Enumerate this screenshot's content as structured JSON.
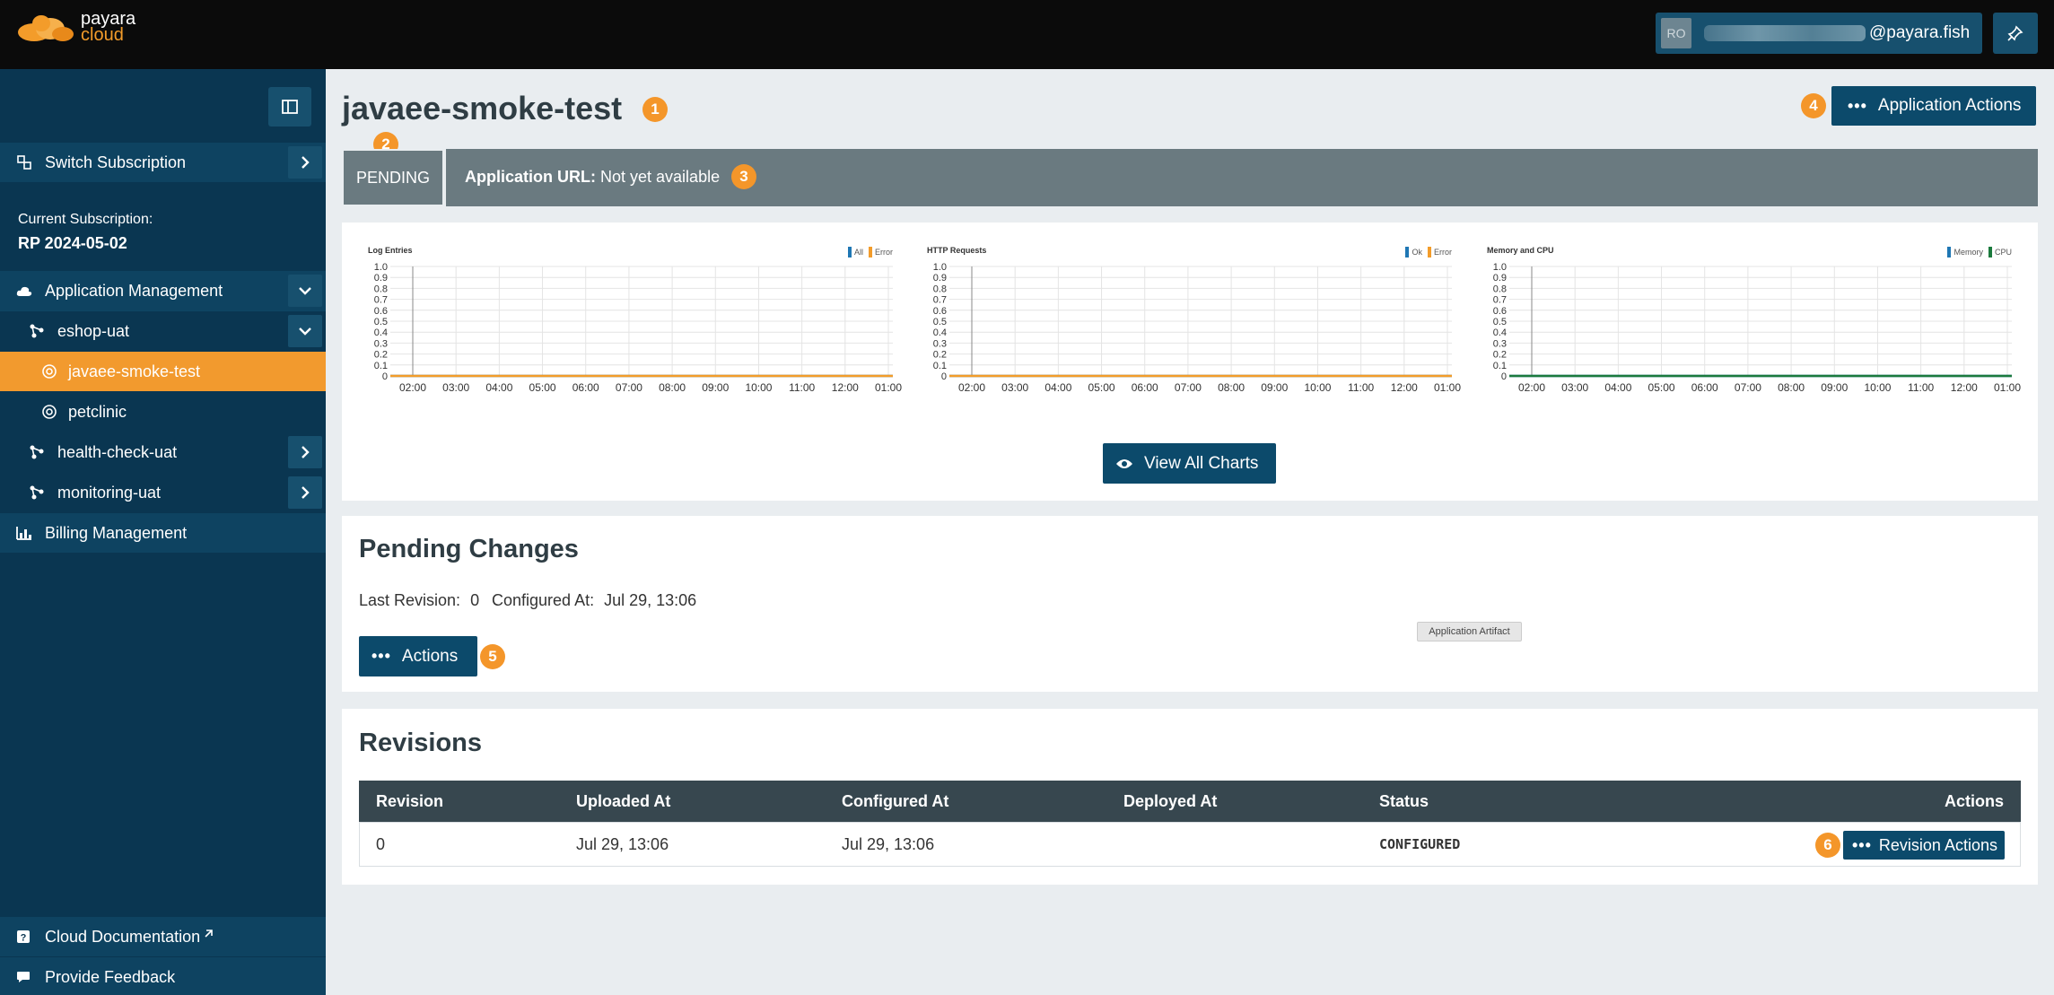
{
  "brand": {
    "line1": "payara",
    "line2": "cloud"
  },
  "user": {
    "avatar_initials": "RO",
    "email": "@payara.fish"
  },
  "sidebar": {
    "switch_subscription": "Switch Subscription",
    "current_subscription_label": "Current Subscription:",
    "current_subscription_value": "RP 2024-05-02",
    "items": [
      {
        "label": "Application Management"
      },
      {
        "label": "eshop-uat"
      },
      {
        "label": "javaee-smoke-test"
      },
      {
        "label": "petclinic"
      },
      {
        "label": "health-check-uat"
      },
      {
        "label": "monitoring-uat"
      },
      {
        "label": "Billing Management"
      }
    ],
    "footer": {
      "docs": "Cloud Documentation",
      "feedback": "Provide Feedback"
    }
  },
  "page": {
    "title": "javaee-smoke-test",
    "status": "PENDING",
    "url_label": "Application URL:",
    "url_value": "Not yet available",
    "app_actions": "Application Actions",
    "view_all_charts": "View All Charts",
    "badges": [
      "1",
      "2",
      "3",
      "4",
      "5",
      "6"
    ]
  },
  "chart_data": [
    {
      "type": "line",
      "title": "Log Entries",
      "x": [
        "02:00",
        "03:00",
        "04:00",
        "05:00",
        "06:00",
        "07:00",
        "08:00",
        "09:00",
        "10:00",
        "11:00",
        "12:00",
        "01:00"
      ],
      "y_ticks": [
        "0",
        "0.1",
        "0.2",
        "0.3",
        "0.4",
        "0.5",
        "0.6",
        "0.7",
        "0.8",
        "0.9",
        "1.0"
      ],
      "ylim": [
        0,
        1
      ],
      "series": [
        {
          "name": "All",
          "color": "#1f77b4",
          "values": [
            0,
            0,
            0,
            0,
            0,
            0,
            0,
            0,
            0,
            0,
            0,
            0
          ]
        },
        {
          "name": "Error",
          "color": "#f39c2a",
          "values": [
            0,
            0,
            0,
            0,
            0,
            0,
            0,
            0,
            0,
            0,
            0,
            0
          ]
        }
      ]
    },
    {
      "type": "line",
      "title": "HTTP Requests",
      "x": [
        "02:00",
        "03:00",
        "04:00",
        "05:00",
        "06:00",
        "07:00",
        "08:00",
        "09:00",
        "10:00",
        "11:00",
        "12:00",
        "01:00"
      ],
      "y_ticks": [
        "0",
        "0.1",
        "0.2",
        "0.3",
        "0.4",
        "0.5",
        "0.6",
        "0.7",
        "0.8",
        "0.9",
        "1.0"
      ],
      "ylim": [
        0,
        1
      ],
      "series": [
        {
          "name": "Ok",
          "color": "#1f77b4",
          "values": [
            0,
            0,
            0,
            0,
            0,
            0,
            0,
            0,
            0,
            0,
            0,
            0
          ]
        },
        {
          "name": "Error",
          "color": "#f39c2a",
          "values": [
            0,
            0,
            0,
            0,
            0,
            0,
            0,
            0,
            0,
            0,
            0,
            0
          ]
        }
      ]
    },
    {
      "type": "line",
      "title": "Memory and CPU",
      "x": [
        "02:00",
        "03:00",
        "04:00",
        "05:00",
        "06:00",
        "07:00",
        "08:00",
        "09:00",
        "10:00",
        "11:00",
        "12:00",
        "01:00"
      ],
      "y_ticks": [
        "0",
        "0.1",
        "0.2",
        "0.3",
        "0.4",
        "0.5",
        "0.6",
        "0.7",
        "0.8",
        "0.9",
        "1.0"
      ],
      "ylim": [
        0,
        1
      ],
      "series": [
        {
          "name": "Memory",
          "color": "#1f77b4",
          "values": [
            0,
            0,
            0,
            0,
            0,
            0,
            0,
            0,
            0,
            0,
            0,
            0
          ]
        },
        {
          "name": "CPU",
          "color": "#1b7a3d",
          "values": [
            0,
            0,
            0,
            0,
            0,
            0,
            0,
            0,
            0,
            0,
            0,
            0
          ]
        }
      ]
    }
  ],
  "pending_changes": {
    "title": "Pending Changes",
    "last_revision_label": "Last Revision:",
    "last_revision_value": "0",
    "configured_at_label": "Configured At:",
    "configured_at_value": "Jul 29, 13:06",
    "actions": "Actions",
    "tooltip": "Application Artifact"
  },
  "revisions": {
    "title": "Revisions",
    "columns": [
      "Revision",
      "Uploaded At",
      "Configured At",
      "Deployed At",
      "Status",
      "Actions"
    ],
    "rows": [
      {
        "revision": "0",
        "uploaded_at": "Jul 29, 13:06",
        "configured_at": "Jul 29, 13:06",
        "deployed_at": "",
        "status": "CONFIGURED",
        "action": "Revision Actions"
      }
    ]
  }
}
